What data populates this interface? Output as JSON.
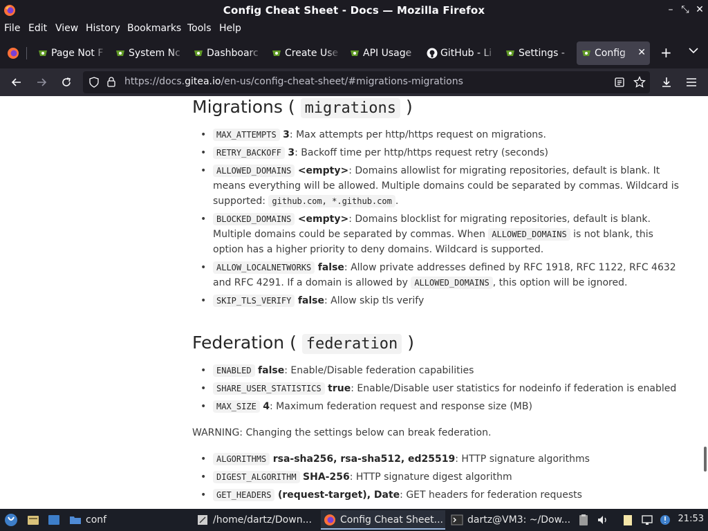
{
  "window": {
    "title": "Config Cheat Sheet - Docs — Mozilla Firefox"
  },
  "menu": {
    "items": [
      "File",
      "Edit",
      "View",
      "History",
      "Bookmarks",
      "Tools",
      "Help"
    ]
  },
  "tabs": [
    {
      "label": "Page Not F"
    },
    {
      "label": "System Nc"
    },
    {
      "label": "Dashboarc"
    },
    {
      "label": "Create Use"
    },
    {
      "label": "API Usage"
    },
    {
      "label": "GitHub - Li"
    },
    {
      "label": "Settings -"
    },
    {
      "label": "Config C"
    }
  ],
  "urlbar": {
    "prefix": "https://docs.",
    "domain": "gitea.io",
    "suffix": "/en-us/config-cheat-sheet/#migrations-migrations"
  },
  "doc": {
    "migrations": {
      "heading": "Migrations",
      "heading_code": "migrations",
      "items": [
        {
          "key": "MAX_ATTEMPTS",
          "value": "3",
          "desc": ": Max attempts per http/https request on migrations."
        },
        {
          "key": "RETRY_BACKOFF",
          "value": "3",
          "desc": ": Backoff time per http/https request retry (seconds)"
        },
        {
          "key": "ALLOWED_DOMAINS",
          "value": "<empty>",
          "desc": ": Domains allowlist for migrating repositories, default is blank. It means everything will be allowed. Multiple domains could be separated by commas. Wildcard is supported:",
          "code_after": "github.com, *.github.com",
          "tail": "."
        },
        {
          "key": "BLOCKED_DOMAINS",
          "value": "<empty>",
          "desc1": ": Domains blocklist for migrating repositories, default is blank. Multiple domains could be separated by commas. When",
          "code_mid": "ALLOWED_DOMAINS",
          "desc2": "is not blank, this option has a higher priority to deny domains. Wildcard is supported."
        },
        {
          "key": "ALLOW_LOCALNETWORKS",
          "value": "false",
          "desc1": ": Allow private addresses defined by RFC 1918, RFC 1122, RFC 4632 and RFC 4291. If a domain is allowed by",
          "code_mid": "ALLOWED_DOMAINS",
          "desc2": ", this option will be ignored."
        },
        {
          "key": "SKIP_TLS_VERIFY",
          "value": "false",
          "desc": ": Allow skip tls verify"
        }
      ]
    },
    "federation": {
      "heading": "Federation",
      "heading_code": "federation",
      "items": [
        {
          "key": "ENABLED",
          "value": "false",
          "desc": ": Enable/Disable federation capabilities"
        },
        {
          "key": "SHARE_USER_STATISTICS",
          "value": "true",
          "desc": ": Enable/Disable user statistics for nodeinfo if federation is enabled"
        },
        {
          "key": "MAX_SIZE",
          "value": "4",
          "desc": ": Maximum federation request and response size (MB)"
        }
      ],
      "warning": "WARNING: Changing the settings below can break federation.",
      "items2": [
        {
          "key": "ALGORITHMS",
          "value": "rsa-sha256, rsa-sha512, ed25519",
          "desc": ": HTTP signature algorithms"
        },
        {
          "key": "DIGEST_ALGORITHM",
          "value": "SHA-256",
          "desc": ": HTTP signature digest algorithm"
        },
        {
          "key": "GET_HEADERS",
          "value": "(request-target), Date",
          "desc": ": GET headers for federation requests"
        }
      ]
    }
  },
  "taskbar": {
    "tasks": [
      {
        "label": "conf"
      },
      {
        "label": "/home/dartz/Down..."
      },
      {
        "label": "Config Cheat Sheet..."
      },
      {
        "label": "dartz@VM3: ~/Dow..."
      }
    ],
    "clock": "21:53"
  },
  "colors": {
    "chrome_dark": "#1c1b22",
    "toolbar": "#2b2a33",
    "gitea_green": "#609926",
    "taskbar": "#1b1e26"
  }
}
